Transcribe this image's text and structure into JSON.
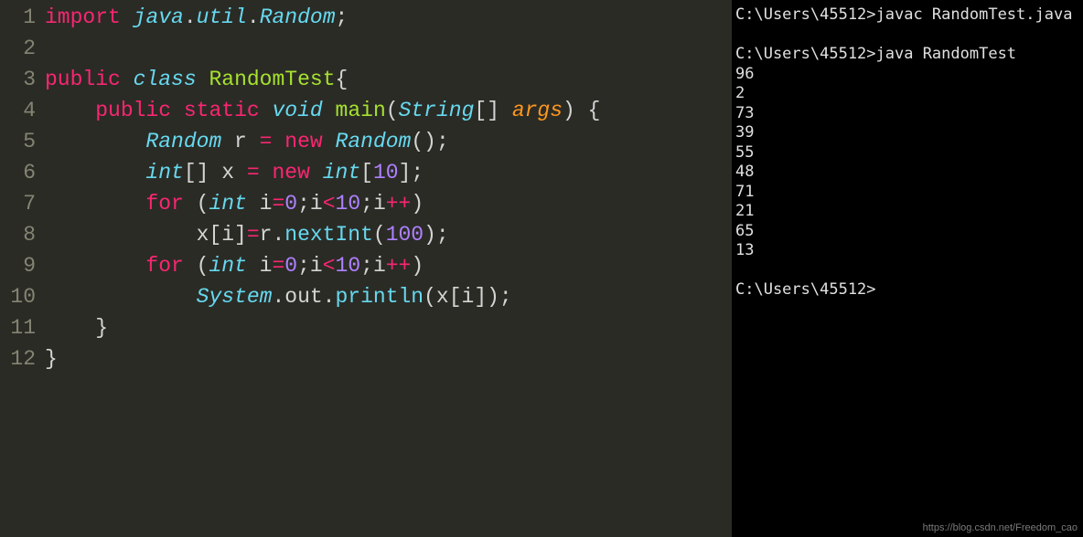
{
  "editor": {
    "line_numbers": [
      "1",
      "2",
      "3",
      "4",
      "5",
      "6",
      "7",
      "8",
      "9",
      "10",
      "11",
      "12"
    ],
    "tokens": [
      [
        {
          "t": "import",
          "c": "kw-pink"
        },
        {
          "t": " ",
          "c": "punct"
        },
        {
          "t": "java",
          "c": "kw-blue"
        },
        {
          "t": ".",
          "c": "punct"
        },
        {
          "t": "util",
          "c": "kw-blue"
        },
        {
          "t": ".",
          "c": "punct"
        },
        {
          "t": "Random",
          "c": "kw-blue"
        },
        {
          "t": ";",
          "c": "punct"
        }
      ],
      [],
      [
        {
          "t": "public",
          "c": "kw-pink"
        },
        {
          "t": " ",
          "c": "punct"
        },
        {
          "t": "class",
          "c": "kw-blue"
        },
        {
          "t": " ",
          "c": "punct"
        },
        {
          "t": "RandomTest",
          "c": "fn-yellow"
        },
        {
          "t": "{",
          "c": "punct"
        }
      ],
      [
        {
          "t": "    ",
          "c": "punct"
        },
        {
          "t": "public",
          "c": "kw-pink"
        },
        {
          "t": " ",
          "c": "punct"
        },
        {
          "t": "static",
          "c": "kw-pink"
        },
        {
          "t": " ",
          "c": "punct"
        },
        {
          "t": "void",
          "c": "kw-blue"
        },
        {
          "t": " ",
          "c": "punct"
        },
        {
          "t": "main",
          "c": "fn-yellow"
        },
        {
          "t": "(",
          "c": "punct"
        },
        {
          "t": "String",
          "c": "kw-blue"
        },
        {
          "t": "[] ",
          "c": "punct"
        },
        {
          "t": "args",
          "c": "var-orange"
        },
        {
          "t": ") {",
          "c": "punct"
        }
      ],
      [
        {
          "t": "        ",
          "c": "punct"
        },
        {
          "t": "Random",
          "c": "kw-blue"
        },
        {
          "t": " r ",
          "c": "ident"
        },
        {
          "t": "=",
          "c": "op"
        },
        {
          "t": " ",
          "c": "punct"
        },
        {
          "t": "new",
          "c": "kw-pink"
        },
        {
          "t": " ",
          "c": "punct"
        },
        {
          "t": "Random",
          "c": "kw-blue"
        },
        {
          "t": "();",
          "c": "punct"
        }
      ],
      [
        {
          "t": "        ",
          "c": "punct"
        },
        {
          "t": "int",
          "c": "kw-blue"
        },
        {
          "t": "[] x ",
          "c": "ident"
        },
        {
          "t": "=",
          "c": "op"
        },
        {
          "t": " ",
          "c": "punct"
        },
        {
          "t": "new",
          "c": "kw-pink"
        },
        {
          "t": " ",
          "c": "punct"
        },
        {
          "t": "int",
          "c": "kw-blue"
        },
        {
          "t": "[",
          "c": "punct"
        },
        {
          "t": "10",
          "c": "num-purple"
        },
        {
          "t": "];",
          "c": "punct"
        }
      ],
      [
        {
          "t": "        ",
          "c": "punct"
        },
        {
          "t": "for",
          "c": "kw-pink"
        },
        {
          "t": " (",
          "c": "punct"
        },
        {
          "t": "int",
          "c": "kw-blue"
        },
        {
          "t": " i",
          "c": "ident"
        },
        {
          "t": "=",
          "c": "op"
        },
        {
          "t": "0",
          "c": "num-purple"
        },
        {
          "t": ";i",
          "c": "ident"
        },
        {
          "t": "<",
          "c": "op"
        },
        {
          "t": "10",
          "c": "num-purple"
        },
        {
          "t": ";i",
          "c": "ident"
        },
        {
          "t": "++",
          "c": "op"
        },
        {
          "t": ")",
          "c": "punct"
        }
      ],
      [
        {
          "t": "            x[i]",
          "c": "ident"
        },
        {
          "t": "=",
          "c": "op"
        },
        {
          "t": "r.",
          "c": "ident"
        },
        {
          "t": "nextInt",
          "c": "fn-print"
        },
        {
          "t": "(",
          "c": "punct"
        },
        {
          "t": "100",
          "c": "num-purple"
        },
        {
          "t": ");",
          "c": "punct"
        }
      ],
      [
        {
          "t": "        ",
          "c": "punct"
        },
        {
          "t": "for",
          "c": "kw-pink"
        },
        {
          "t": " (",
          "c": "punct"
        },
        {
          "t": "int",
          "c": "kw-blue"
        },
        {
          "t": " i",
          "c": "ident"
        },
        {
          "t": "=",
          "c": "op"
        },
        {
          "t": "0",
          "c": "num-purple"
        },
        {
          "t": ";i",
          "c": "ident"
        },
        {
          "t": "<",
          "c": "op"
        },
        {
          "t": "10",
          "c": "num-purple"
        },
        {
          "t": ";i",
          "c": "ident"
        },
        {
          "t": "++",
          "c": "op"
        },
        {
          "t": ")",
          "c": "punct"
        }
      ],
      [
        {
          "t": "            ",
          "c": "punct"
        },
        {
          "t": "System",
          "c": "kw-blue"
        },
        {
          "t": ".out.",
          "c": "ident"
        },
        {
          "t": "println",
          "c": "fn-print"
        },
        {
          "t": "(x[i]);",
          "c": "ident"
        }
      ],
      [
        {
          "t": "    }",
          "c": "punct"
        }
      ],
      [
        {
          "t": "}",
          "c": "punct"
        }
      ]
    ]
  },
  "terminal": {
    "lines": [
      "C:\\Users\\45512>javac RandomTest.java",
      "",
      "C:\\Users\\45512>java RandomTest",
      "96",
      "2",
      "73",
      "39",
      "55",
      "48",
      "71",
      "21",
      "65",
      "13",
      "",
      "C:\\Users\\45512>"
    ]
  },
  "watermark": "https://blog.csdn.net/Freedom_cao"
}
